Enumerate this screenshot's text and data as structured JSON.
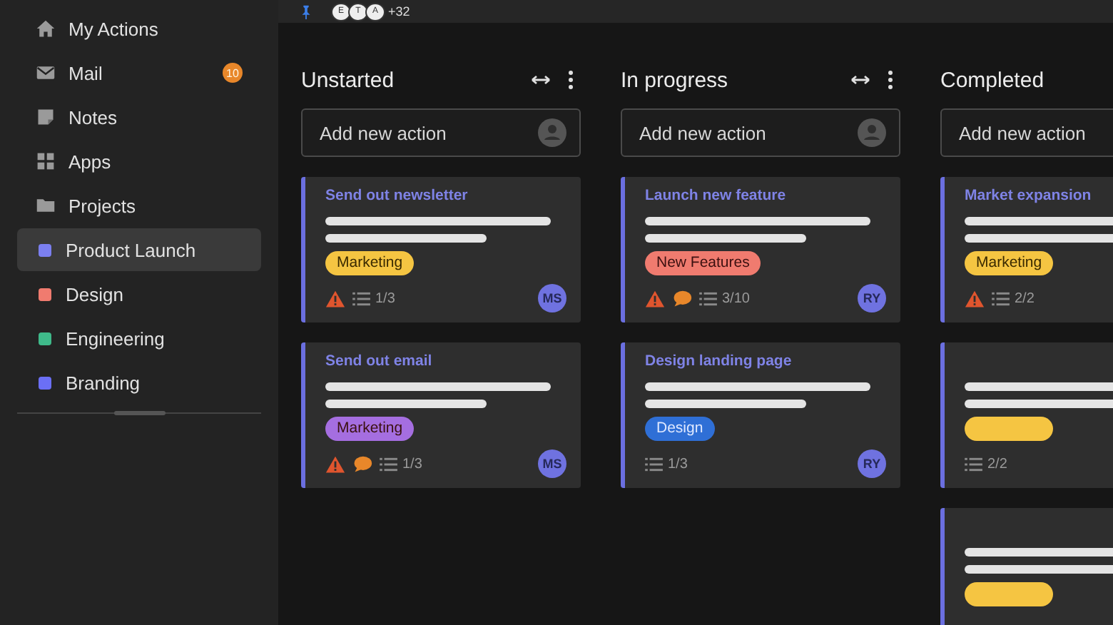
{
  "sidebar": {
    "items": [
      {
        "kind": "nav",
        "label": "My Actions",
        "selected": false
      },
      {
        "kind": "nav",
        "label": "Mail",
        "badge": "10",
        "selected": false
      },
      {
        "kind": "nav",
        "label": "Notes",
        "selected": false
      },
      {
        "kind": "nav",
        "label": "Apps",
        "selected": false
      },
      {
        "kind": "nav",
        "label": "Projects",
        "selected": false
      },
      {
        "kind": "project",
        "label": "Product Launch",
        "color": "#7b7ff0",
        "selected": true
      },
      {
        "kind": "project",
        "label": "Design",
        "color": "#f07b6f",
        "selected": false
      },
      {
        "kind": "project",
        "label": "Engineering",
        "color": "#3fba8a",
        "selected": false
      },
      {
        "kind": "project",
        "label": "Branding",
        "color": "#6b6ff5",
        "selected": false
      }
    ]
  },
  "top_bar": {
    "members": [
      "E",
      "T",
      "A"
    ],
    "more": "+32"
  },
  "columns": [
    {
      "title": "Unstarted",
      "add_placeholder": "Add new action",
      "controls": true,
      "cards": [
        {
          "title": "Send out newsletter",
          "tag": {
            "label": "Marketing",
            "color": "#f5c542"
          },
          "warning": true,
          "comment": false,
          "checklist": "1/3",
          "assignee": "MS"
        },
        {
          "title": "Send out email",
          "tag": {
            "label": "Marketing",
            "color": "#a56ee0"
          },
          "warning": true,
          "comment": true,
          "checklist": "1/3",
          "assignee": "MS"
        }
      ]
    },
    {
      "title": "In progress",
      "add_placeholder": "Add new action",
      "controls": true,
      "cards": [
        {
          "title": "Launch new feature",
          "tag": {
            "label": "New Features",
            "color": "#f07b6f"
          },
          "warning": true,
          "comment": true,
          "checklist": "3/10",
          "assignee": "RY"
        },
        {
          "title": "Design landing page",
          "tag": {
            "label": "Design",
            "color": "#2f6fd6"
          },
          "warning": false,
          "comment": false,
          "checklist": "1/3",
          "assignee": "RY"
        }
      ]
    },
    {
      "title": "Completed",
      "add_placeholder": "Add new action",
      "controls": false,
      "cards": [
        {
          "title": "Market expansion",
          "tag": {
            "label": "Marketing",
            "color": "#f5c542"
          },
          "warning": true,
          "comment": false,
          "checklist": "2/2"
        },
        {
          "tag": {
            "color": "#f5c542"
          },
          "warning": false,
          "comment": false,
          "checklist": "2/2"
        },
        {
          "tag": {
            "color": "#f5c542"
          },
          "warning": false,
          "comment": false
        }
      ]
    }
  ]
}
